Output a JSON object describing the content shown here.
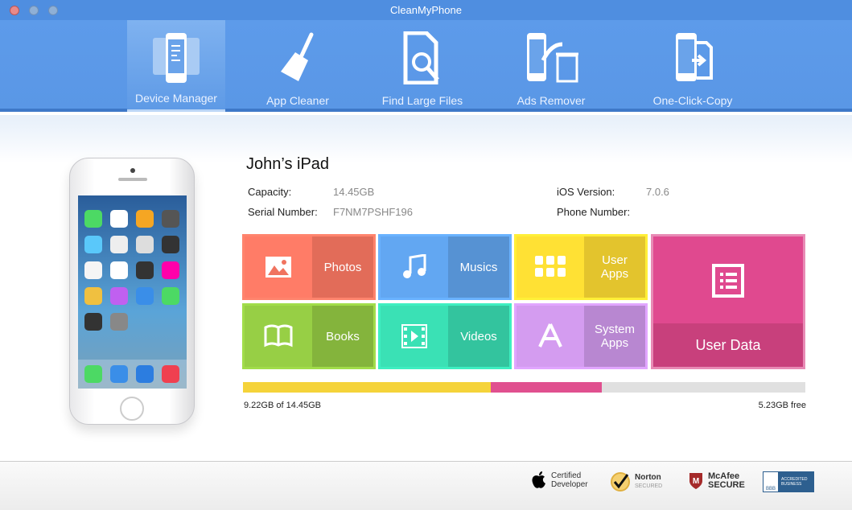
{
  "window": {
    "title": "CleanMyPhone"
  },
  "toolbar": {
    "items": [
      {
        "label": "Device Manager",
        "icon": "device-manager-icon",
        "active": true
      },
      {
        "label": "App Cleaner",
        "icon": "broom-icon"
      },
      {
        "label": "Find Large Files",
        "icon": "file-search-icon"
      },
      {
        "label": "Ads Remover",
        "icon": "ads-remover-icon"
      },
      {
        "label": "One-Click-Copy",
        "icon": "copy-icon"
      }
    ]
  },
  "device": {
    "name": "John’s iPad",
    "capacity_label": "Capacity:",
    "capacity": "14.45GB",
    "serial_label": "Serial Number:",
    "serial": "F7NM7PSHF196",
    "ios_label": "iOS Version:",
    "ios": "7.0.6",
    "phone_label": "Phone Number:",
    "phone": ""
  },
  "tiles": [
    {
      "label": "Photos",
      "icon": "image-icon",
      "color": "#f0735f"
    },
    {
      "label": "Musics",
      "icon": "music-icon",
      "color": "#5b9be0"
    },
    {
      "label": "User Apps",
      "icon": "apps-grid-icon",
      "color": "#f2d030"
    },
    {
      "label": "Books",
      "icon": "book-icon",
      "color": "#8cc040"
    },
    {
      "label": "Videos",
      "icon": "film-icon",
      "color": "#36d0a8"
    },
    {
      "label": "System Apps",
      "icon": "app-store-icon",
      "color": "#c490de"
    },
    {
      "label": "User Data",
      "icon": "list-icon",
      "color": "#e0498f"
    }
  ],
  "storage": {
    "used_text": "9.22GB of 14.45GB",
    "free_text": "5.23GB free",
    "used_gb": 9.22,
    "total_gb": 14.45,
    "segments": [
      {
        "gb": 6.37,
        "color": "#f5d33a"
      },
      {
        "gb": 2.85,
        "color": "#e0508f"
      }
    ]
  },
  "footer": {
    "badges": [
      {
        "text1": "Certified",
        "text2": "Developer",
        "icon": "apple-icon"
      },
      {
        "text1": "Norton",
        "text2": "SECURED",
        "icon": "norton-check-icon"
      },
      {
        "text1": "McAfee",
        "text2": "SECURE",
        "icon": "mcafee-shield-icon"
      },
      {
        "text1": "ACCREDITED",
        "text2": "BUSINESS",
        "icon": "bbb-icon"
      }
    ]
  }
}
